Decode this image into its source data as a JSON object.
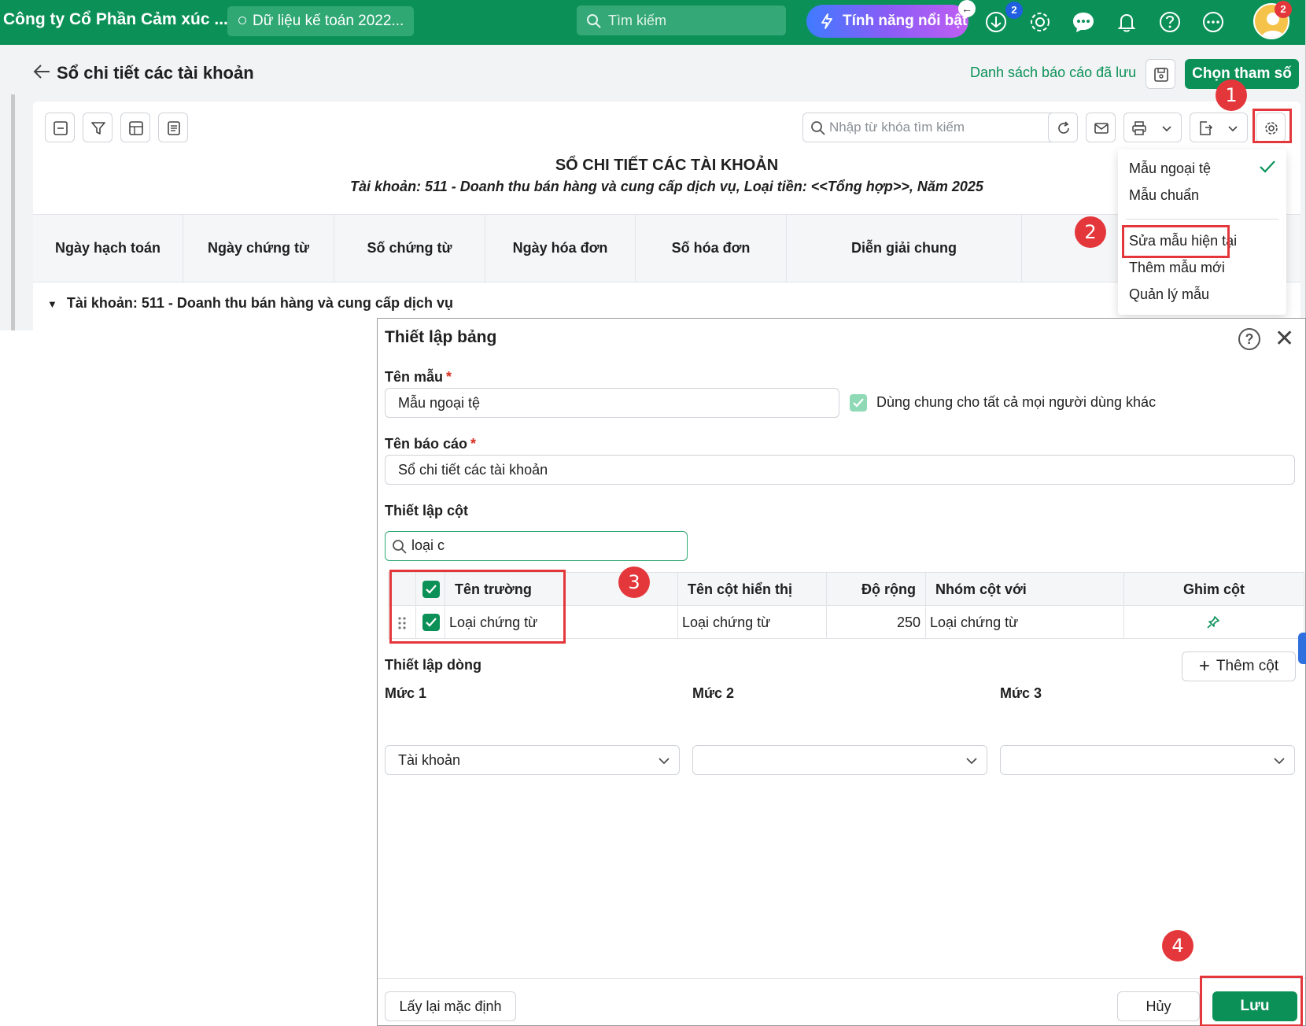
{
  "topbar": {
    "company": "Công ty Cổ Phần Cảm xúc ...",
    "data_pill": "Dữ liệu kế toán 2022...",
    "search_placeholder": "Tìm kiếm",
    "feature_label": "Tính năng nổi bật",
    "download_badge": "2",
    "avatar_badge": "2",
    "brand_color": "#0b9158"
  },
  "header": {
    "title": "Sổ chi tiết các tài khoản",
    "saved_reports": "Danh sách báo cáo đã lưu",
    "choose_params": "Chọn tham số"
  },
  "report": {
    "search_placeholder": "Nhập từ khóa tìm kiếm",
    "title": "SỔ CHI TIẾT CÁC TÀI KHOẢN",
    "subtitle": "Tài khoản: 511 - Doanh thu bán hàng và cung cấp dịch vụ, Loại tiền: <<Tổng hợp>>, Năm 2025",
    "columns": [
      "Ngày hạch toán",
      "Ngày chứng từ",
      "Số chứng từ",
      "Ngày hóa đơn",
      "Số hóa đơn",
      "Diễn giải chung"
    ],
    "group_row": "Tài khoản:  511 - Doanh thu bán hàng và cung cấp dịch vụ"
  },
  "template_menu": {
    "items": [
      "Mẫu ngoại tệ",
      "Mẫu chuẩn",
      "Sửa mẫu hiện tại",
      "Thêm mẫu mới",
      "Quản lý mẫu"
    ]
  },
  "steps": [
    "1",
    "2",
    "3",
    "4"
  ],
  "dialog": {
    "title": "Thiết lập bảng",
    "template_name_label": "Tên mẫu",
    "template_name_value": "Mẫu ngoại tệ",
    "share_label": "Dùng chung cho tất cả mọi người dùng khác",
    "report_name_label": "Tên báo cáo",
    "report_name_value": "Sổ chi tiết các tài khoản",
    "column_setup_label": "Thiết lập cột",
    "column_search_value": "loại c",
    "column_table": {
      "headers": [
        "Tên trường",
        "Tên cột hiển thị",
        "Độ rộng",
        "Nhóm cột với",
        "Ghim cột"
      ],
      "rows": [
        {
          "field": "Loại chứng từ",
          "display": "Loại chứng từ",
          "width": "250",
          "group": "Loại chứng từ"
        }
      ]
    },
    "add_column": "Thêm cột",
    "row_setup_label": "Thiết lập dòng",
    "levels": [
      {
        "label": "Mức 1",
        "value": "Tài khoản"
      },
      {
        "label": "Mức 2",
        "value": ""
      },
      {
        "label": "Mức 3",
        "value": ""
      }
    ],
    "reset_default": "Lấy lại mặc định",
    "cancel": "Hủy",
    "save": "Lưu"
  }
}
